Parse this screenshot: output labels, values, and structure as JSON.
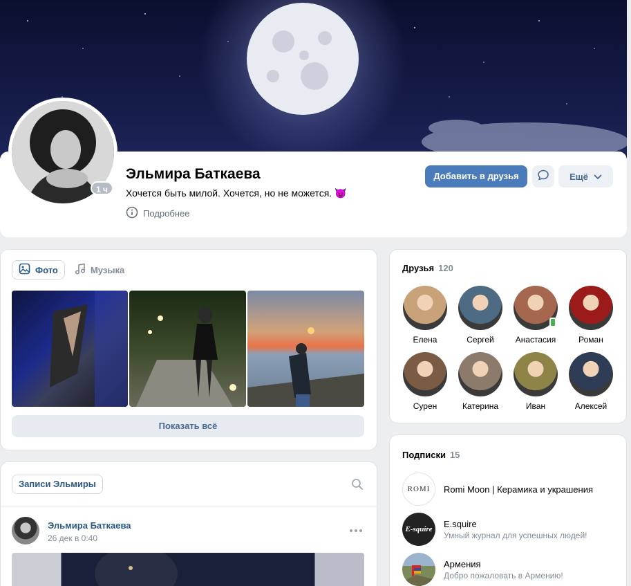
{
  "profile": {
    "name": "Эльмира Баткаева",
    "status": "Хочется быть милой. Хочется, но не можется. 😈",
    "more_info": "Подробнее",
    "last_seen": "1 ч",
    "add_friend": "Добавить в друзья",
    "more_btn": "Ещё"
  },
  "media": {
    "tabs": [
      {
        "label": "Фото",
        "icon": "image-icon",
        "active": true
      },
      {
        "label": "Музыка",
        "icon": "music-note-icon",
        "active": false
      }
    ],
    "show_all": "Показать всё"
  },
  "wall": {
    "tab": "Записи Эльмиры",
    "post": {
      "author": "Эльмира Баткаева",
      "date": "26 дек в 0:40"
    }
  },
  "friends": {
    "title": "Друзья",
    "count": "120",
    "items": [
      {
        "name": "Елена",
        "color": "#c9a27a"
      },
      {
        "name": "Сергей",
        "color": "#4d6b83"
      },
      {
        "name": "Анастасия",
        "color": "#a6674f",
        "online": true
      },
      {
        "name": "Роман",
        "color": "#9b1b1b"
      },
      {
        "name": "Сурен",
        "color": "#7a5b44"
      },
      {
        "name": "Катерина",
        "color": "#8c7a6a"
      },
      {
        "name": "Иван",
        "color": "#8e8448"
      },
      {
        "name": "Алексей",
        "color": "#2e3d55"
      }
    ]
  },
  "subscriptions": {
    "title": "Подписки",
    "count": "15",
    "items": [
      {
        "name": "Romi Moon | Керамика и украшения",
        "desc": "",
        "logo": "ROMI"
      },
      {
        "name": "E.squire",
        "desc": "Умный журнал для успешных людей!",
        "logo": "E-squire"
      },
      {
        "name": "Армения",
        "desc": "Добро пожаловать в Армению!",
        "logo": ""
      }
    ]
  },
  "colors": {
    "accent": "#4a7cbb",
    "link": "#2a5885",
    "online": "#4bb34b"
  }
}
